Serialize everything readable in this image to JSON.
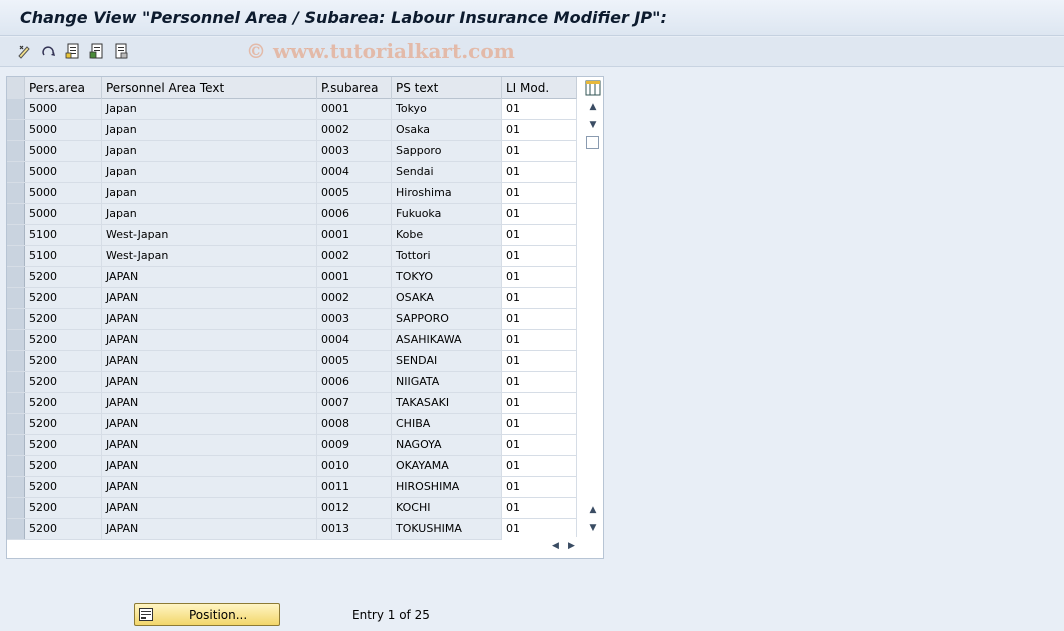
{
  "window": {
    "title": "Change View \"Personnel Area / Subarea: Labour Insurance Modifier JP\":"
  },
  "toolbar": {
    "buttons": [
      "edit-icon",
      "undo-icon",
      "new-entries-icon",
      "copy-icon",
      "delete-icon"
    ],
    "watermark": "© www.tutorialkart.com"
  },
  "table": {
    "columns": [
      "Pers.area",
      "Personnel Area Text",
      "P.subarea",
      "PS text",
      "LI Mod."
    ],
    "rows": [
      [
        "5000",
        "Japan",
        "0001",
        "Tokyo",
        "01"
      ],
      [
        "5000",
        "Japan",
        "0002",
        "Osaka",
        "01"
      ],
      [
        "5000",
        "Japan",
        "0003",
        "Sapporo",
        "01"
      ],
      [
        "5000",
        "Japan",
        "0004",
        "Sendai",
        "01"
      ],
      [
        "5000",
        "Japan",
        "0005",
        "Hiroshima",
        "01"
      ],
      [
        "5000",
        "Japan",
        "0006",
        "Fukuoka",
        "01"
      ],
      [
        "5100",
        "West-Japan",
        "0001",
        "Kobe",
        "01"
      ],
      [
        "5100",
        "West-Japan",
        "0002",
        "Tottori",
        "01"
      ],
      [
        "5200",
        "JAPAN",
        "0001",
        "TOKYO",
        "01"
      ],
      [
        "5200",
        "JAPAN",
        "0002",
        "OSAKA",
        "01"
      ],
      [
        "5200",
        "JAPAN",
        "0003",
        "SAPPORO",
        "01"
      ],
      [
        "5200",
        "JAPAN",
        "0004",
        "ASAHIKAWA",
        "01"
      ],
      [
        "5200",
        "JAPAN",
        "0005",
        "SENDAI",
        "01"
      ],
      [
        "5200",
        "JAPAN",
        "0006",
        "NIIGATA",
        "01"
      ],
      [
        "5200",
        "JAPAN",
        "0007",
        "TAKASAKI",
        "01"
      ],
      [
        "5200",
        "JAPAN",
        "0008",
        "CHIBA",
        "01"
      ],
      [
        "5200",
        "JAPAN",
        "0009",
        "NAGOYA",
        "01"
      ],
      [
        "5200",
        "JAPAN",
        "0010",
        "OKAYAMA",
        "01"
      ],
      [
        "5200",
        "JAPAN",
        "0011",
        "HIROSHIMA",
        "01"
      ],
      [
        "5200",
        "JAPAN",
        "0012",
        "KOCHI",
        "01"
      ],
      [
        "5200",
        "JAPAN",
        "0013",
        "TOKUSHIMA",
        "01"
      ]
    ]
  },
  "footer": {
    "position_button": "Position...",
    "entry_text": "Entry 1 of 25"
  }
}
